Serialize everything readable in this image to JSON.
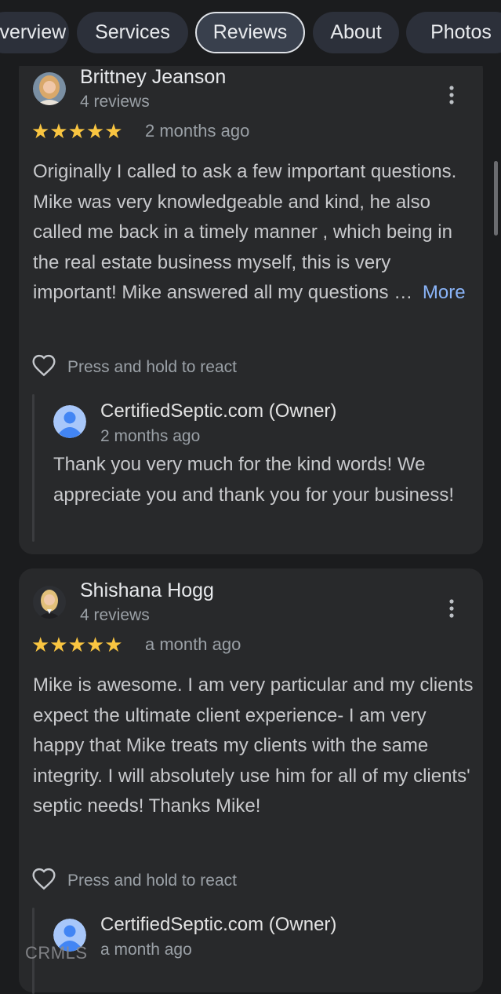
{
  "tabs": [
    {
      "label": "Overview"
    },
    {
      "label": "Services"
    },
    {
      "label": "Reviews",
      "active": true
    },
    {
      "label": "About"
    },
    {
      "label": "Photos"
    }
  ],
  "reviews": [
    {
      "name": "Brittney Jeanson",
      "review_count": "4 reviews",
      "rating": 5,
      "stars": "★★★★★",
      "date": "2 months ago",
      "text": "Originally I called to ask a few important questions. Mike was very knowledgeable and kind, he also called me back in a timely manner , which being in the real estate business myself, this is very important! Mike answered all my questions …",
      "more_label": "More",
      "react_label": "Press and hold to react",
      "reply": {
        "owner": "CertifiedSeptic.com (Owner)",
        "date": "2 months ago",
        "text": "Thank you very much for the kind words! We appreciate you and thank you for your business!"
      }
    },
    {
      "name": "Shishana Hogg",
      "review_count": "4 reviews",
      "rating": 5,
      "stars": "★★★★★",
      "date": "a month ago",
      "text": "Mike is awesome. I am very particular and my clients expect the ultimate client experience- I am very happy that Mike treats my clients with the same integrity. I will absolutely use him for all of my clients' septic needs! Thanks Mike!",
      "react_label": "Press and hold to react",
      "reply": {
        "owner": "CertifiedSeptic.com (Owner)",
        "date": "a month ago"
      }
    }
  ],
  "watermark": "CRMLS",
  "icons": {
    "menu": "more-vert-icon",
    "react": "heart-outline-icon",
    "owner_avatar": "person-avatar-icon"
  },
  "colors": {
    "background": "#1b1c1e",
    "card": "#28292b",
    "star": "#f9c541",
    "link": "#8ab4f8",
    "tab_bg": "#2c303a"
  }
}
